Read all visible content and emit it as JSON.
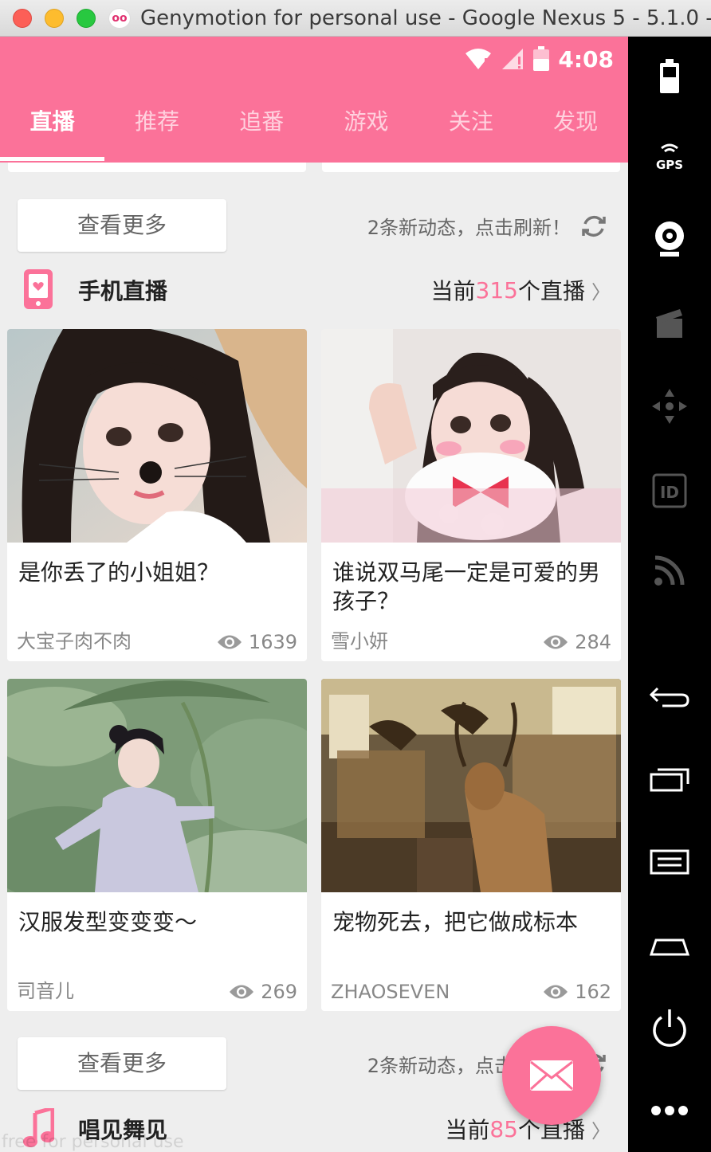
{
  "window": {
    "title": "Genymotion for personal use - Google Nexus 5 - 5.1.0 -..."
  },
  "status_bar": {
    "time": "4:08"
  },
  "tabs": [
    {
      "label": "直播"
    },
    {
      "label": "推荐"
    },
    {
      "label": "追番"
    },
    {
      "label": "游戏"
    },
    {
      "label": "关注"
    },
    {
      "label": "发现"
    }
  ],
  "block1": {
    "more_label": "查看更多",
    "refresh_text": "2条新动态，点击刷新！"
  },
  "section1": {
    "title": "手机直播",
    "count_prefix": "当前",
    "count": "315",
    "count_suffix": "个直播"
  },
  "cards": [
    {
      "title": "是你丢了的小姐姐？",
      "owner": "大宝子肉不肉",
      "views": "1639"
    },
    {
      "title": "谁说双马尾一定是可爱的男孩子？",
      "owner": "雪小妍",
      "views": "284"
    },
    {
      "title": "汉服发型变变变～",
      "owner": "司音儿",
      "views": "269"
    },
    {
      "title": "宠物死去，把它做成标本",
      "owner": "ZHAOSEVEN",
      "views": "162"
    }
  ],
  "block2": {
    "more_label": "查看更多",
    "refresh_text": "2条新动态，点击刷新！"
  },
  "section2": {
    "title": "唱见舞见",
    "count_prefix": "当前",
    "count": "85",
    "count_suffix": "个直播"
  },
  "watermark": "free for personal use",
  "sidebar": {
    "gps_label": "GPS",
    "id_label": "ID"
  },
  "colors": {
    "accent": "#fb7299",
    "background": "#eeeeee"
  }
}
